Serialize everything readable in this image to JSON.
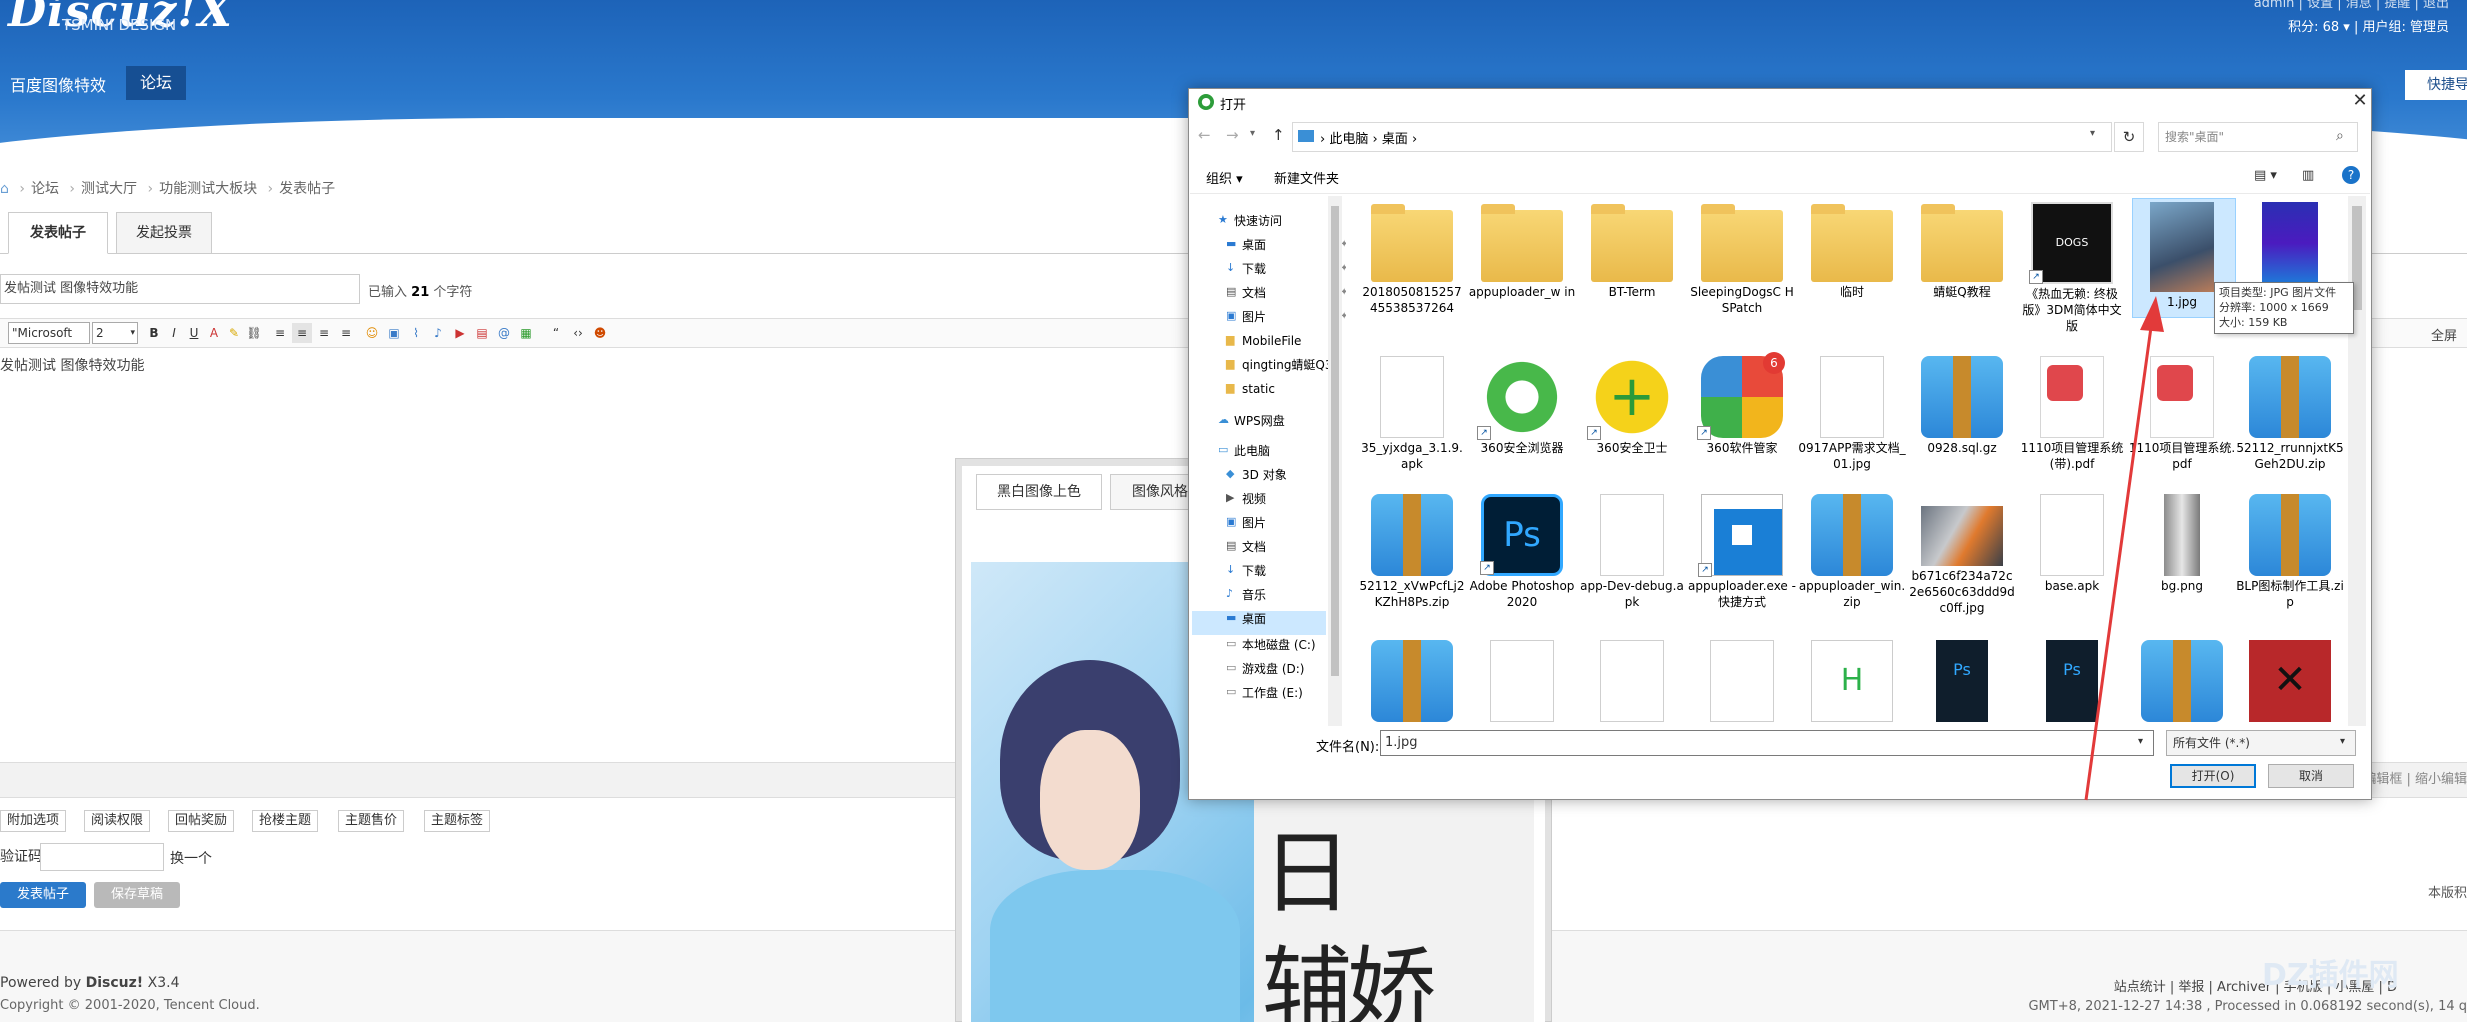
{
  "header": {
    "logo": "Discuz!X",
    "logo_sub": "TSMINI DESIGN",
    "nav": [
      "百度图像特效",
      "论坛"
    ],
    "toplinks": "admin | 设置 | 消息 | 提醒 | 退出",
    "credits": "积分: 68 ▾ | 用户组: 管理员",
    "quick_nav": "快捷导"
  },
  "breadcrumb": [
    "论坛",
    "测试大厅",
    "功能测试大板块",
    "发表帖子"
  ],
  "tabs": [
    "发表帖子",
    "发起投票"
  ],
  "subject": {
    "value": "发帖测试 图像特效功能"
  },
  "counter": {
    "prefix": "已输入",
    "count": "21",
    "suffix": "个字符"
  },
  "toolbar": {
    "font": "\"Microsoft",
    "size": "2",
    "fullscreen": "全屏"
  },
  "editor": {
    "content": "发帖测试 图像特效功能",
    "footer_right": "编辑框 | 缩小编辑"
  },
  "options": [
    "附加选项",
    "阅读权限",
    "回帖奖励",
    "抢楼主题",
    "主题售价",
    "主题标签"
  ],
  "captcha": {
    "label": "验证码",
    "change": "换一个"
  },
  "buttons": {
    "post": "发表帖子",
    "draft": "保存草稿"
  },
  "right_note": "本版积",
  "footer": {
    "powered_prefix": "Powered by",
    "powered_brand": "Discuz!",
    "powered_ver": "X3.4",
    "copyright": "Copyright © 2001-2020, Tencent Cloud.",
    "links": "站点统计 | 举报 | Archiver | 手机版 | 小黑屋 | D",
    "gmt": "GMT+8, 2021-12-27 14:38 , Processed in 0.068192 second(s), 14 q",
    "watermark": "DZ插件网"
  },
  "fx_panel": {
    "tabs": [
      "黑白图像上色",
      "图像风格"
    ],
    "img_text1": "日",
    "img_text2": "辅娇"
  },
  "dialog": {
    "title": "打开",
    "address": [
      "此电脑",
      "桌面"
    ],
    "search_placeholder": "搜索\"桌面\"",
    "organize": "组织 ▾",
    "new_folder": "新建文件夹",
    "nav_items": [
      {
        "label": "快速访问",
        "icon": "star-icon",
        "pin": false,
        "header": true
      },
      {
        "label": "桌面",
        "icon": "desktop-icon",
        "pin": true
      },
      {
        "label": "下载",
        "icon": "download-icon",
        "pin": true
      },
      {
        "label": "文档",
        "icon": "document-icon",
        "pin": true
      },
      {
        "label": "图片",
        "icon": "picture-icon",
        "pin": true
      },
      {
        "label": "MobileFile",
        "icon": "folder-icon",
        "pin": false
      },
      {
        "label": "qingting蜻蜓Q3",
        "icon": "folder-icon",
        "pin": false
      },
      {
        "label": "static",
        "icon": "folder-icon",
        "pin": false
      },
      {
        "label": "WPS网盘",
        "icon": "cloud-icon",
        "pin": false,
        "header": true
      },
      {
        "label": "此电脑",
        "icon": "computer-icon",
        "pin": false,
        "header": true
      },
      {
        "label": "3D 对象",
        "icon": "cube-icon",
        "pin": false
      },
      {
        "label": "视频",
        "icon": "video-icon",
        "pin": false
      },
      {
        "label": "图片",
        "icon": "picture-icon",
        "pin": false
      },
      {
        "label": "文档",
        "icon": "document-icon",
        "pin": false
      },
      {
        "label": "下载",
        "icon": "download-icon",
        "pin": false
      },
      {
        "label": "音乐",
        "icon": "music-icon",
        "pin": false
      },
      {
        "label": "桌面",
        "icon": "desktop-icon",
        "pin": false,
        "selected": true
      },
      {
        "label": "本地磁盘 (C:)",
        "icon": "drive-icon",
        "pin": false
      },
      {
        "label": "游戏盘 (D:)",
        "icon": "drive-icon",
        "pin": false
      },
      {
        "label": "工作盘 (E:)",
        "icon": "drive-icon",
        "pin": false
      }
    ],
    "files": [
      {
        "name": "2018050815257 45538537264",
        "kind": "folder"
      },
      {
        "name": "appuploader_w in",
        "kind": "folder"
      },
      {
        "name": "BT-Term",
        "kind": "folder"
      },
      {
        "name": "SleepingDogsC HSPatch",
        "kind": "folder"
      },
      {
        "name": "临时",
        "kind": "folder"
      },
      {
        "name": "蜻蜓Q教程",
        "kind": "folder"
      },
      {
        "name": "《热血无赖: 终极版》3DM简体中文版",
        "kind": "game"
      },
      {
        "name": "1.jpg",
        "kind": "photo"
      },
      {
        "name": "",
        "kind": "gradient"
      },
      {
        "name": "35_yjxdga_3.1.9.apk",
        "kind": "doc"
      },
      {
        "name": "360安全浏览器",
        "kind": "browser"
      },
      {
        "name": "360安全卫士",
        "kind": "guard"
      },
      {
        "name": "360软件管家",
        "kind": "manager"
      },
      {
        "name": "0917APP需求文档_01.jpg",
        "kind": "doc"
      },
      {
        "name": "0928.sql.gz",
        "kind": "zip"
      },
      {
        "name": "1110项目管理系统(带).pdf",
        "kind": "pdf"
      },
      {
        "name": "1110项目管理系统.pdf",
        "kind": "pdf"
      },
      {
        "name": "52112_rrunnjxtK5Geh2DU.zip",
        "kind": "zip"
      },
      {
        "name": "52112_xVwPcfLj2KZhH8Ps.zip",
        "kind": "zip"
      },
      {
        "name": "Adobe Photoshop 2020",
        "kind": "ps"
      },
      {
        "name": "app-Dev-debug.apk",
        "kind": "doc"
      },
      {
        "name": "appuploader.exe - 快捷方式",
        "kind": "exe"
      },
      {
        "name": "appuploader_win.zip",
        "kind": "zip"
      },
      {
        "name": "b671c6f234a72c2e6560c63ddd9dc0ff.jpg",
        "kind": "photo2"
      },
      {
        "name": "base.apk",
        "kind": "doc"
      },
      {
        "name": "bg.png",
        "kind": "gray"
      },
      {
        "name": "BLP图标制作工具.zip",
        "kind": "zip"
      },
      {
        "name": "",
        "kind": "zip"
      },
      {
        "name": "",
        "kind": "doc"
      },
      {
        "name": "",
        "kind": "doc"
      },
      {
        "name": "",
        "kind": "doc"
      },
      {
        "name": "",
        "kind": "hbuilder"
      },
      {
        "name": "",
        "kind": "ps2"
      },
      {
        "name": "",
        "kind": "ps2"
      },
      {
        "name": "",
        "kind": "zip"
      },
      {
        "name": "",
        "kind": "dota"
      }
    ],
    "tooltip": [
      "项目类型: JPG 图片文件",
      "分辨率: 1000 x 1669",
      "大小: 159 KB"
    ],
    "filename_label": "文件名(N):",
    "filename_value": "1.jpg",
    "filetype": "所有文件 (*.*)",
    "open": "打开(O)",
    "cancel": "取消"
  },
  "colors": {
    "header": "#1d63b8",
    "accent": "#2b7acb",
    "selection": "#cce8ff",
    "arrow": "#e23a3a"
  }
}
